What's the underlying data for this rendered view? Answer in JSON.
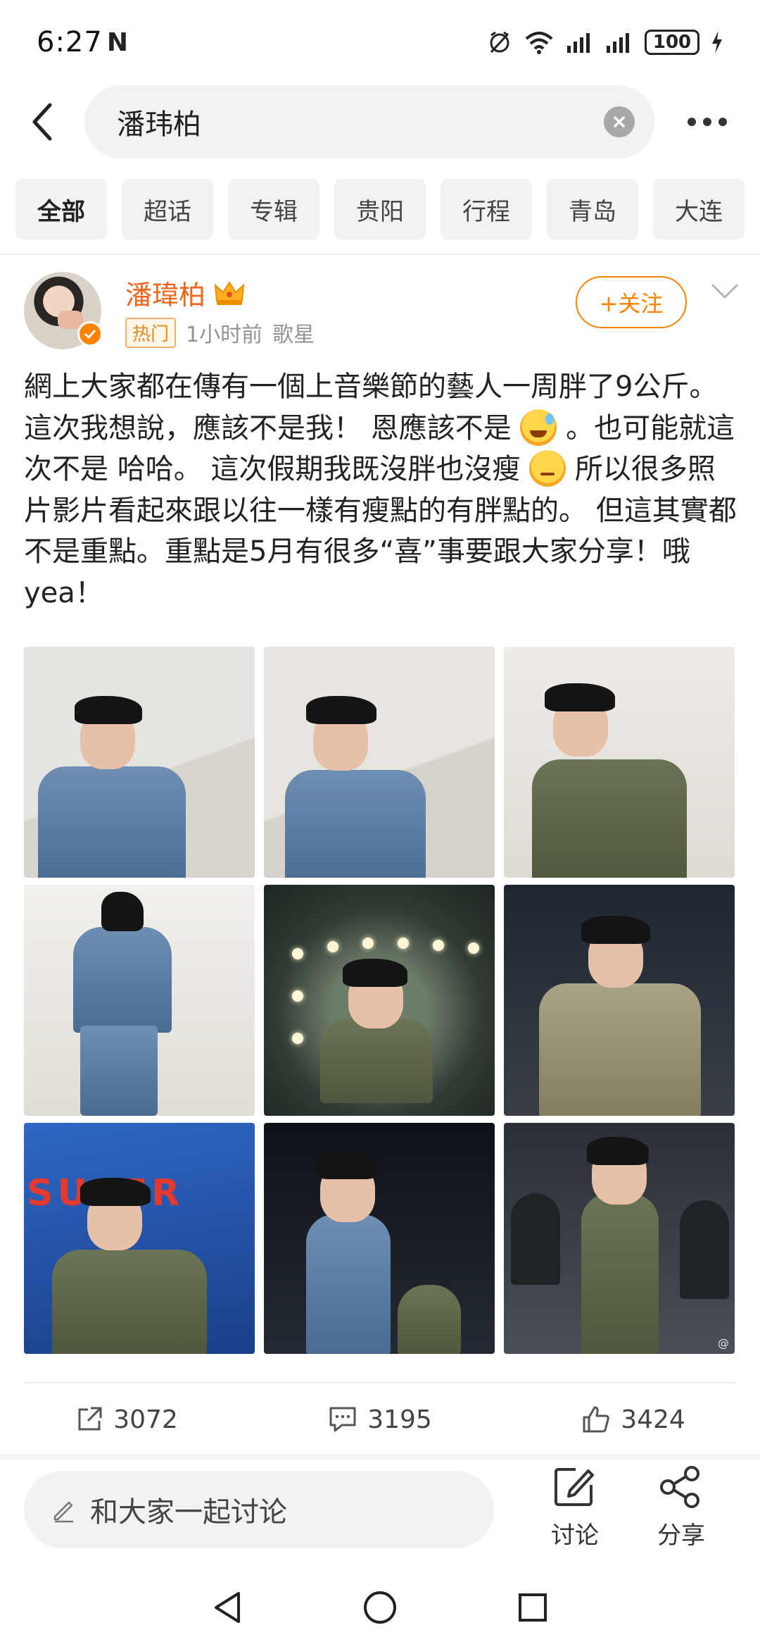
{
  "status_bar": {
    "time": "6:27",
    "n_indicator": "N",
    "battery": "100"
  },
  "search": {
    "query": "潘玮柏"
  },
  "filters": [
    {
      "label": "全部",
      "active": true
    },
    {
      "label": "超话"
    },
    {
      "label": "专辑"
    },
    {
      "label": "贵阳"
    },
    {
      "label": "行程"
    },
    {
      "label": "青岛"
    },
    {
      "label": "大连"
    }
  ],
  "post": {
    "author": "潘瑋柏",
    "badge": "热门",
    "time": "1小时前",
    "category": "歌星",
    "follow_label": "+关注",
    "text_part1": "網上大家都在傳有一個上音樂節的藝人一周胖了9公斤。這次我想說，應該不是我！ 恩應該不是",
    "text_part2": "。也可能就這次不是 哈哈。 這次假期我既沒胖也沒瘦",
    "text_part3": "所以很多照片影片看起來跟以往一樣有瘦點的有胖點的。 但這其實都不是重點。重點是5月有很多“喜”事要跟大家分享！哦yea！",
    "photos": [
      "photo-1",
      "photo-2",
      "photo-3",
      "photo-4",
      "photo-5",
      "photo-6",
      "photo-7",
      "photo-8",
      "photo-9"
    ],
    "stage_text": "SUPER",
    "watermark": "@"
  },
  "actions": {
    "reposts": "3072",
    "comments": "3195",
    "likes": "3424"
  },
  "bottom_bar": {
    "comment_placeholder": "和大家一起讨论",
    "discuss_label": "讨论",
    "share_label": "分享"
  },
  "colors": {
    "accent": "#ff8200",
    "author": "#f2661c"
  }
}
